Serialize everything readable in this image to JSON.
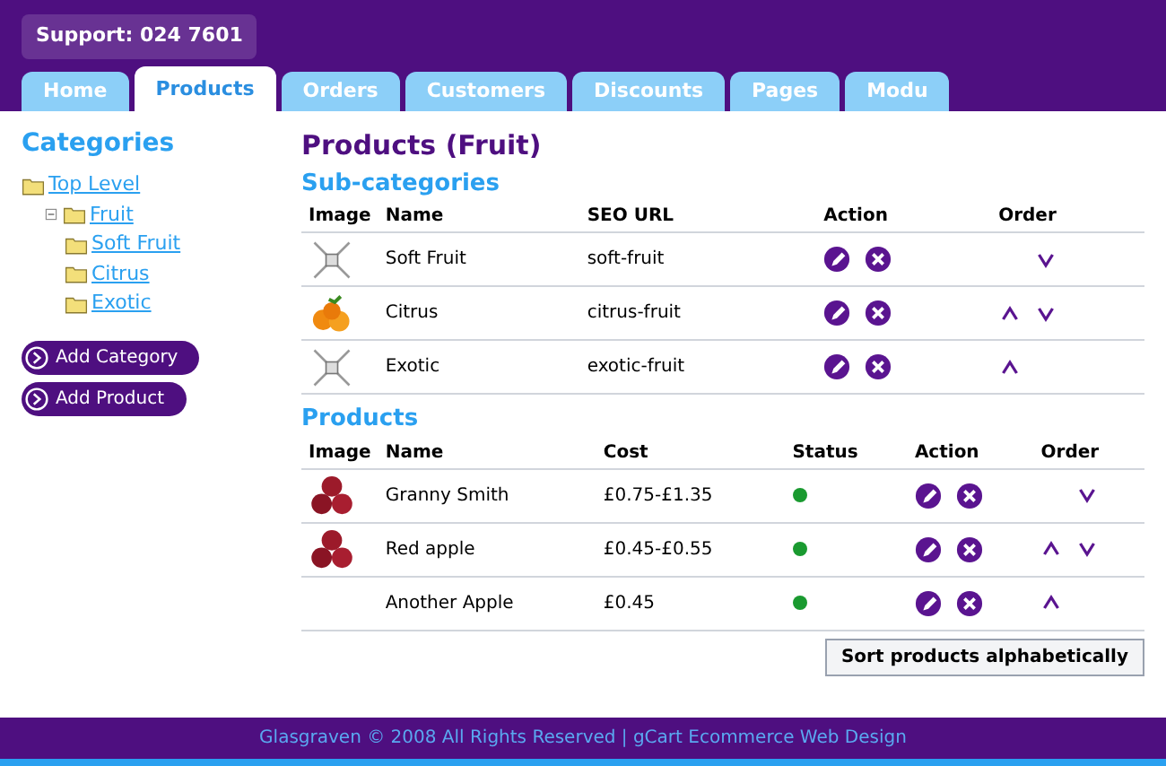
{
  "header": {
    "support": "Support: 024 7601"
  },
  "tabs": [
    {
      "label": "Home",
      "selected": false
    },
    {
      "label": "Products",
      "selected": true
    },
    {
      "label": "Orders",
      "selected": false
    },
    {
      "label": "Customers",
      "selected": false
    },
    {
      "label": "Discounts",
      "selected": false
    },
    {
      "label": "Pages",
      "selected": false
    },
    {
      "label": "Modu",
      "selected": false
    }
  ],
  "sidebar": {
    "title": "Categories",
    "tree": [
      {
        "label": "Top Level",
        "children": [
          {
            "label": "Fruit",
            "expanded": true,
            "children": [
              {
                "label": "Soft Fruit"
              },
              {
                "label": "Citrus"
              },
              {
                "label": "Exotic"
              }
            ]
          }
        ]
      }
    ],
    "buttons": [
      "Add Category",
      "Add Product"
    ]
  },
  "page_title": "Products (Fruit)",
  "subcategories": {
    "title": "Sub-categories",
    "columns": [
      "Image",
      "Name",
      "SEO URL",
      "Action",
      "Order"
    ],
    "rows": [
      {
        "kind": "broken",
        "name": "Soft Fruit",
        "seo_url": "soft-fruit",
        "move_up": false,
        "move_down": true
      },
      {
        "kind": "orange",
        "name": "Citrus",
        "seo_url": "citrus-fruit",
        "move_up": true,
        "move_down": true
      },
      {
        "kind": "broken",
        "name": "Exotic",
        "seo_url": "exotic-fruit",
        "move_up": true,
        "move_down": false
      }
    ]
  },
  "products": {
    "title": "Products",
    "columns": [
      "Image",
      "Name",
      "Cost",
      "Status",
      "Action",
      "Order"
    ],
    "rows": [
      {
        "kind": "apple",
        "name": "Granny Smith",
        "cost": "£0.75-£1.35",
        "active": true,
        "move_up": false,
        "move_down": true
      },
      {
        "kind": "apple",
        "name": "Red apple",
        "cost": "£0.45-£0.55",
        "active": true,
        "move_up": true,
        "move_down": true
      },
      {
        "kind": "none",
        "name": "Another Apple",
        "cost": "£0.45",
        "active": true,
        "move_up": true,
        "move_down": false
      }
    ],
    "sort_button": "Sort products alphabetically"
  },
  "footer": "Glasgraven © 2008 All Rights Reserved | gCart Ecommerce Web Design"
}
